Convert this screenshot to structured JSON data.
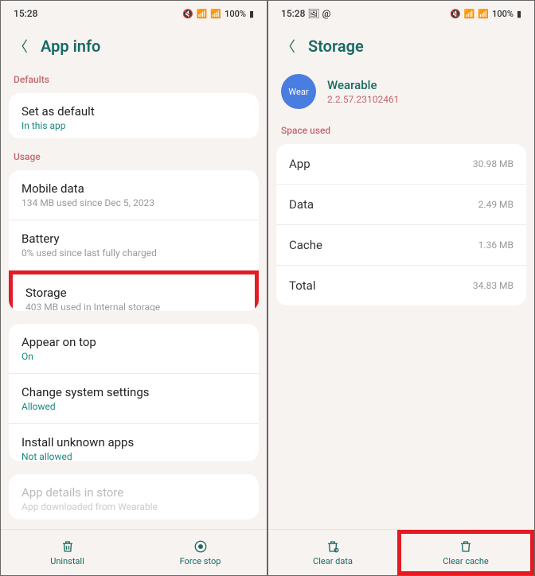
{
  "left": {
    "status": {
      "time": "15:28",
      "battery": "100%"
    },
    "header": {
      "title": "App info"
    },
    "sections": {
      "defaults_label": "Defaults",
      "defaults_item": {
        "title": "Set as default",
        "sub": "In this app"
      },
      "usage_label": "Usage",
      "usage_items": [
        {
          "title": "Mobile data",
          "sub": "134 MB used since Dec 5, 2023"
        },
        {
          "title": "Battery",
          "sub": "0% used since last fully charged"
        },
        {
          "title": "Storage",
          "sub": "403 MB used in Internal storage"
        }
      ],
      "perm_items": [
        {
          "title": "Appear on top",
          "sub": "On"
        },
        {
          "title": "Change system settings",
          "sub": "Allowed"
        },
        {
          "title": "Install unknown apps",
          "sub": "Not allowed"
        }
      ],
      "store_item": {
        "title": "App details in store",
        "sub": "App downloaded from Wearable"
      }
    },
    "bottom": {
      "uninstall": "Uninstall",
      "forcestop": "Force stop"
    }
  },
  "right": {
    "status": {
      "time": "15:28",
      "battery": "100%"
    },
    "header": {
      "title": "Storage"
    },
    "app": {
      "icon": "Wear",
      "name": "Wearable",
      "version": "2.2.57.23102461"
    },
    "space_label": "Space used",
    "rows": [
      {
        "label": "App",
        "value": "30.98 MB"
      },
      {
        "label": "Data",
        "value": "2.49 MB"
      },
      {
        "label": "Cache",
        "value": "1.36 MB"
      },
      {
        "label": "Total",
        "value": "34.83 MB"
      }
    ],
    "bottom": {
      "cleardata": "Clear data",
      "clearcache": "Clear cache"
    }
  }
}
